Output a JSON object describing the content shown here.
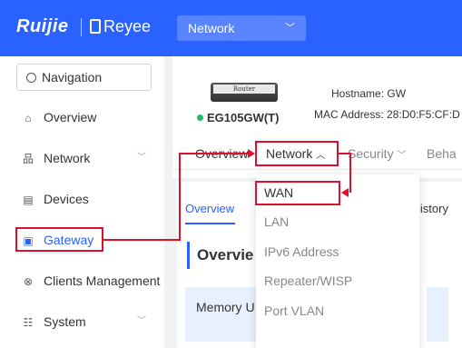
{
  "header": {
    "brand": "Ruijie",
    "brand2": "Reyee",
    "network_select": "Network"
  },
  "sidebar": {
    "search": "Navigation",
    "items": [
      {
        "label": "Overview",
        "icon": "home-icon"
      },
      {
        "label": "Network",
        "icon": "network-icon"
      },
      {
        "label": "Devices",
        "icon": "devices-icon"
      },
      {
        "label": "Gateway",
        "icon": "gateway-icon"
      },
      {
        "label": "Clients Management",
        "icon": "clients-icon"
      },
      {
        "label": "System",
        "icon": "system-icon"
      }
    ]
  },
  "device": {
    "image_label": "Router",
    "hostname_label": "Hostname:",
    "hostname": "GW",
    "mac_label": "MAC Address:",
    "mac": "28:D0:F5:CF:D",
    "model": "EG105GW(T)"
  },
  "tabs": [
    "Overview",
    "Network",
    "Security",
    "Beha"
  ],
  "subtabs": [
    "Overview",
    "listory"
  ],
  "overview_title": "Overvie",
  "memory_label": "Memory U",
  "dropdown": [
    "WAN",
    "LAN",
    "IPv6 Address",
    "Repeater/WISP",
    "Port VLAN"
  ],
  "colors": {
    "brand": "#2a62ff",
    "highlight": "#e0102d",
    "online": "#19be6b"
  }
}
